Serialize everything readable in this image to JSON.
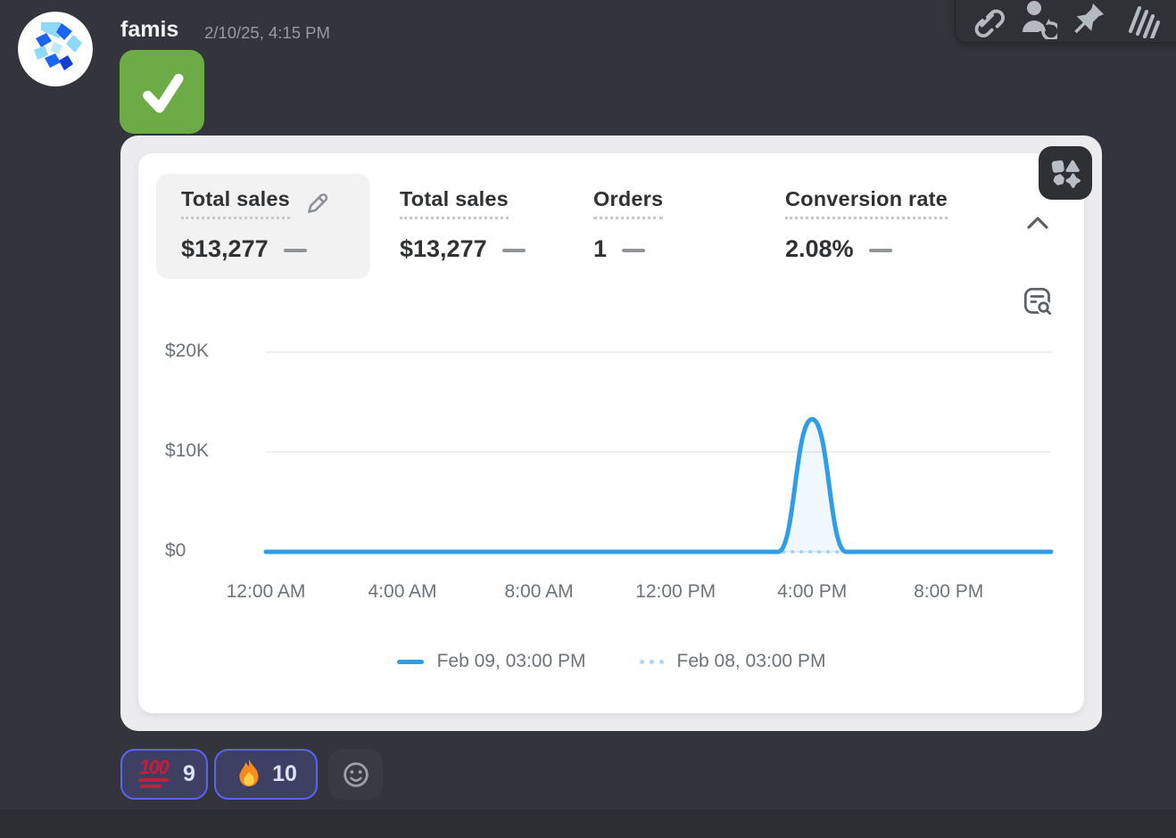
{
  "colors": {
    "accent_blurple": "#5865f2",
    "chart_line_blue": "#2f9ee4",
    "chart_compare_blue": "#a6d7f5",
    "emoji_green": "#6cab46",
    "card_bg": "#ffffff",
    "embed_bg": "#ececee"
  },
  "message": {
    "author": "famis",
    "timestamp": "2/10/25, 4:15 PM",
    "content_emoji": "white-check-mark"
  },
  "toolbar": {
    "icons": [
      "link",
      "history-person",
      "pin",
      "swipe-lines",
      "smiley"
    ]
  },
  "dashboard": {
    "metrics": [
      {
        "label": "Total sales",
        "value": "$13,277",
        "selected": true,
        "editable": true
      },
      {
        "label": "Total sales",
        "value": "$13,277",
        "selected": false
      },
      {
        "label": "Orders",
        "value": "1",
        "selected": false
      },
      {
        "label": "Conversion rate",
        "value": "2.08%",
        "selected": false
      }
    ]
  },
  "chart_data": {
    "type": "line",
    "title": "",
    "xlabel": "",
    "ylabel": "",
    "ylim": [
      0,
      20000
    ],
    "x_hours_domain": [
      0,
      23
    ],
    "grid": "horizontal",
    "legend_position": "bottom",
    "y_ticks": [
      {
        "label": "$20K",
        "value": 20000
      },
      {
        "label": "$10K",
        "value": 10000
      },
      {
        "label": "$0",
        "value": 0
      }
    ],
    "x_ticks": [
      {
        "label": "12:00 AM",
        "hour": 0
      },
      {
        "label": "4:00 AM",
        "hour": 4
      },
      {
        "label": "8:00 AM",
        "hour": 8
      },
      {
        "label": "12:00 PM",
        "hour": 12
      },
      {
        "label": "4:00 PM",
        "hour": 16
      },
      {
        "label": "8:00 PM",
        "hour": 20
      }
    ],
    "series": [
      {
        "name": "Feb 09, 03:00 PM",
        "style": "solid",
        "color": "#2f9ee4",
        "points": [
          [
            0,
            0
          ],
          [
            1,
            0
          ],
          [
            2,
            0
          ],
          [
            3,
            0
          ],
          [
            4,
            0
          ],
          [
            5,
            0
          ],
          [
            6,
            0
          ],
          [
            7,
            0
          ],
          [
            8,
            0
          ],
          [
            9,
            0
          ],
          [
            10,
            0
          ],
          [
            11,
            0
          ],
          [
            12,
            0
          ],
          [
            13,
            0
          ],
          [
            14,
            0
          ],
          [
            15,
            0
          ],
          [
            16,
            13277
          ],
          [
            17,
            0
          ],
          [
            18,
            0
          ],
          [
            19,
            0
          ],
          [
            20,
            0
          ],
          [
            21,
            0
          ],
          [
            22,
            0
          ],
          [
            23,
            0
          ]
        ]
      },
      {
        "name": "Feb 08, 03:00 PM",
        "style": "dotted",
        "color": "#a6d7f5",
        "points": [
          [
            0,
            0
          ],
          [
            23,
            0
          ]
        ]
      }
    ]
  },
  "reactions": [
    {
      "emoji": "100",
      "count": "9",
      "reacted": true
    },
    {
      "emoji": "fire",
      "count": "10",
      "reacted": true
    }
  ]
}
